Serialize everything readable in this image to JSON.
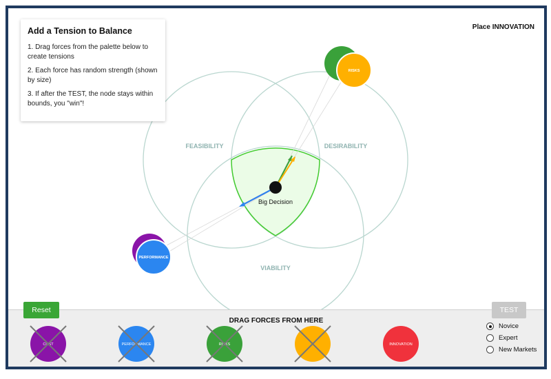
{
  "instructions": {
    "title": "Add a Tension to Balance",
    "steps": [
      "1. Drag forces from the palette below to create tensions",
      "2. Each force has random strength (shown by size)",
      "3. If after the TEST, the node stays within bounds, you \"win\"!"
    ]
  },
  "place_label": "Place INNOVATION",
  "venn": {
    "labels": [
      "FEASIBILITY",
      "DESIRABILITY",
      "VIABILITY"
    ],
    "node_label": "Big Decision"
  },
  "placed_forces": [
    {
      "label": "",
      "color": "#3aa13a"
    },
    {
      "label": "RISKS",
      "color": "#ffb000"
    },
    {
      "label": "",
      "color": "#8a14a8"
    },
    {
      "label": "PERFORMANCE",
      "color": "#2b86f0"
    }
  ],
  "palette": {
    "title": "DRAG FORCES FROM HERE",
    "items": [
      {
        "label": "COST",
        "color": "#8a14a8",
        "used": true
      },
      {
        "label": "PERFORMANCE",
        "color": "#2b86f0",
        "used": true
      },
      {
        "label": "RISKS",
        "color": "#3aa13a",
        "used": true
      },
      {
        "label": "",
        "color": "#ffb000",
        "used": true
      },
      {
        "label": "INNOVATION",
        "color": "#f0323c",
        "used": false
      }
    ]
  },
  "buttons": {
    "reset": "Reset",
    "test": "TEST"
  },
  "levels": {
    "options": [
      "Novice",
      "Expert",
      "New Markets"
    ],
    "selected": "Novice"
  }
}
